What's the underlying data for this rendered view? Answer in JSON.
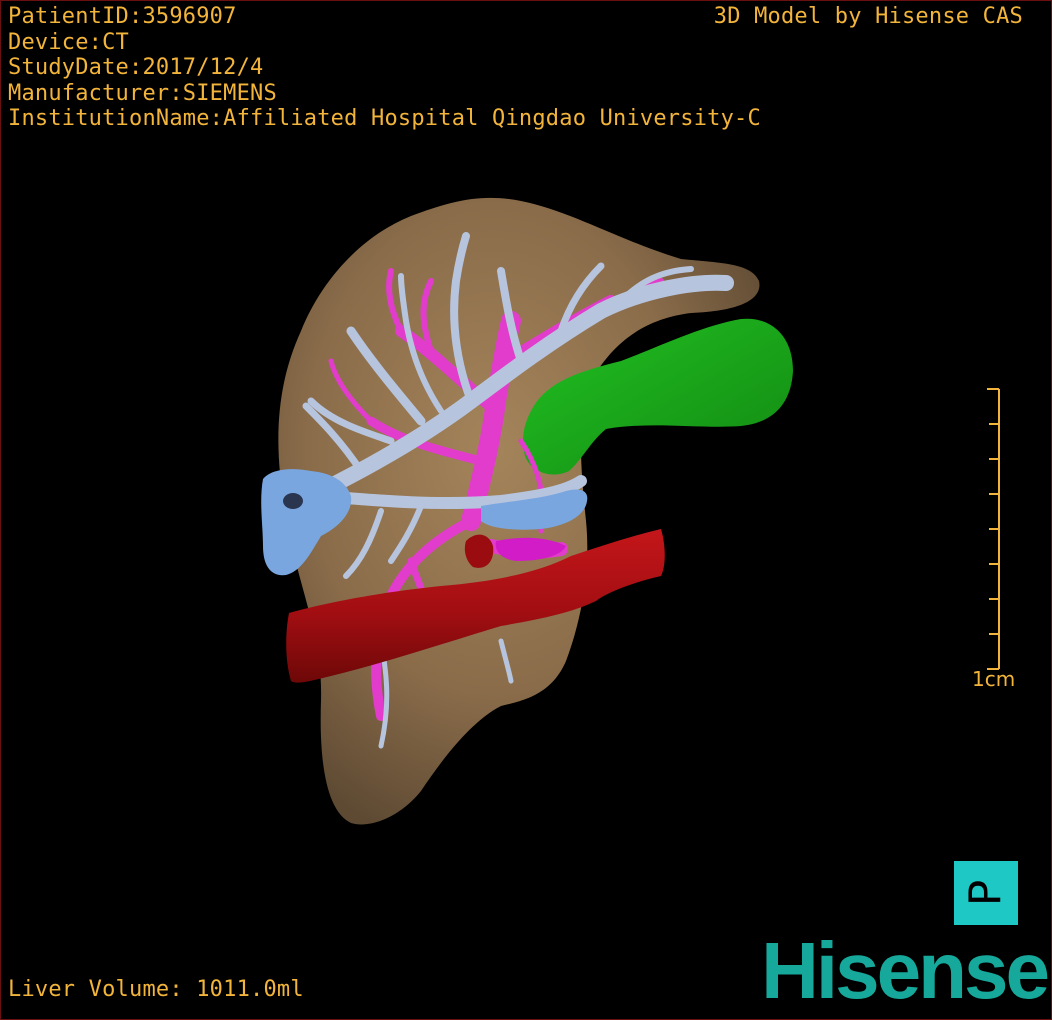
{
  "header": {
    "patient_id": "PatientID:3596907",
    "device": "Device:CT",
    "study_date": "StudyDate:2017/12/4",
    "manufacturer": "Manufacturer:SIEMENS",
    "institution": "InstitutionName:Affiliated Hospital Qingdao University-C",
    "credit": "3D Model by Hisense CAS"
  },
  "footer": {
    "liver_volume": "Liver Volume: 1011.0ml",
    "logo": "Hisense"
  },
  "scale_bar": {
    "label": "1cm"
  },
  "orientation": {
    "label": "P"
  },
  "colors": {
    "overlay_text": "#f2b43a",
    "liver": "#8a6c4a",
    "hepatic_vein": "#b7c4de",
    "portal_vein": "#e23ccc",
    "vena_cava": "#aa0e12",
    "gallbladder": "#1aa81a",
    "vein_root": "#7aa6e0",
    "orientation_box": "#1ec8c4",
    "logo": "#16a89b"
  }
}
